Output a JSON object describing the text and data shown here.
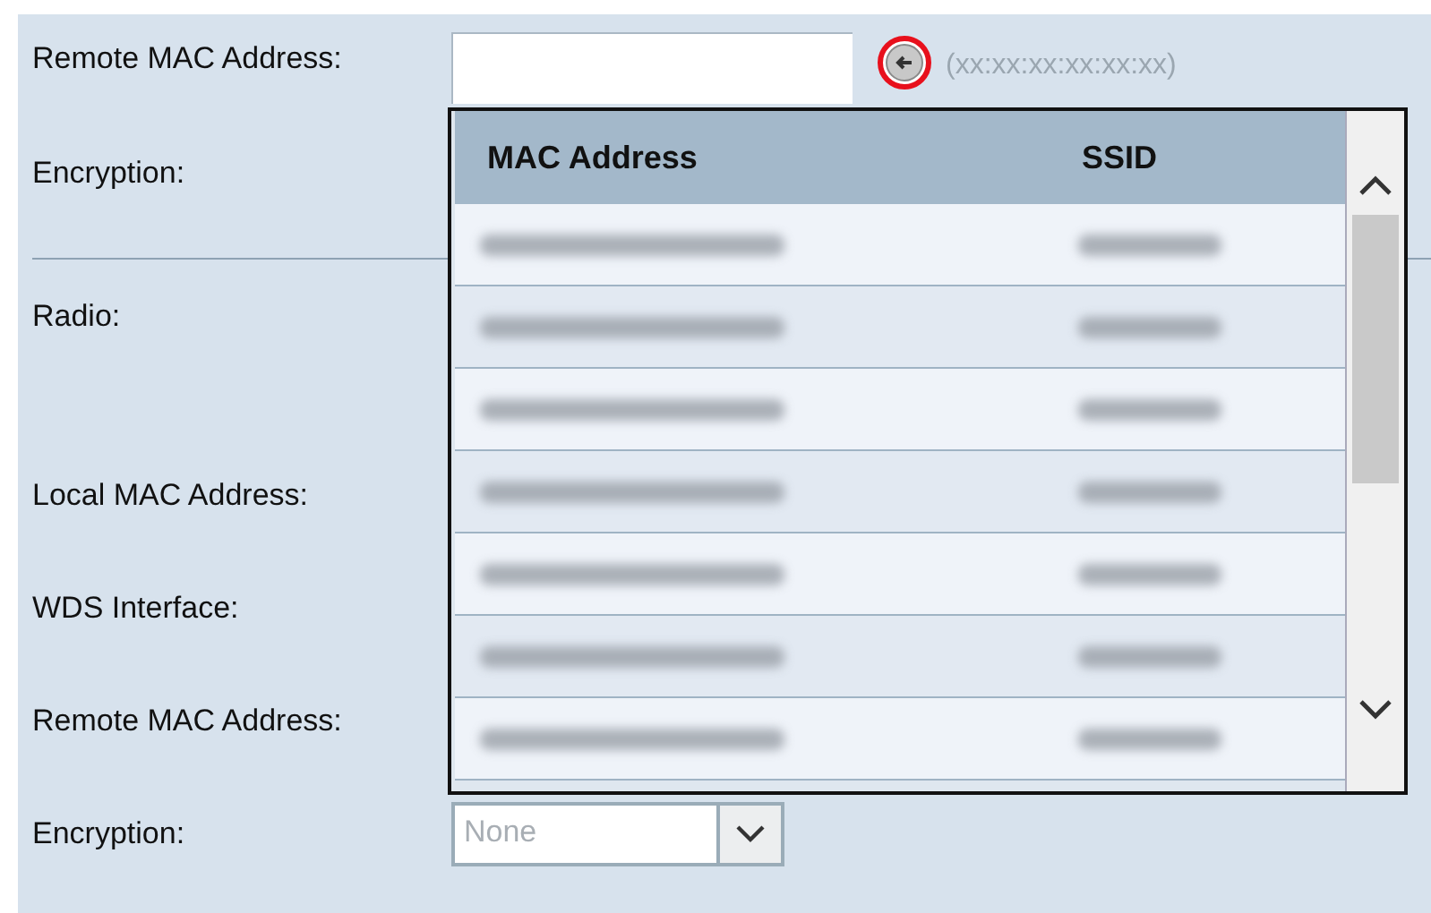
{
  "form": {
    "fields": [
      {
        "label": "Remote MAC Address:",
        "kind": "mac_input",
        "hint": "(xx:xx:xx:xx:xx:xx)"
      },
      {
        "label": "Encryption:",
        "kind": "plain"
      },
      {
        "kind": "divider"
      },
      {
        "label": "Radio:",
        "kind": "tall"
      },
      {
        "label": "Local MAC Address:",
        "kind": "plain"
      },
      {
        "label": "WDS Interface:",
        "kind": "plain"
      },
      {
        "label": "Remote MAC Address:",
        "kind": "plain"
      },
      {
        "label": "Encryption:",
        "kind": "select",
        "value": "None",
        "disabled": true
      }
    ]
  },
  "mac_popup": {
    "columns": [
      "MAC Address",
      "SSID"
    ],
    "rows": [
      {
        "kind": "blurred"
      },
      {
        "kind": "blurred"
      },
      {
        "kind": "blurred"
      },
      {
        "kind": "blurred"
      },
      {
        "kind": "blurred"
      },
      {
        "kind": "blurred"
      },
      {
        "kind": "blurred"
      }
    ]
  }
}
